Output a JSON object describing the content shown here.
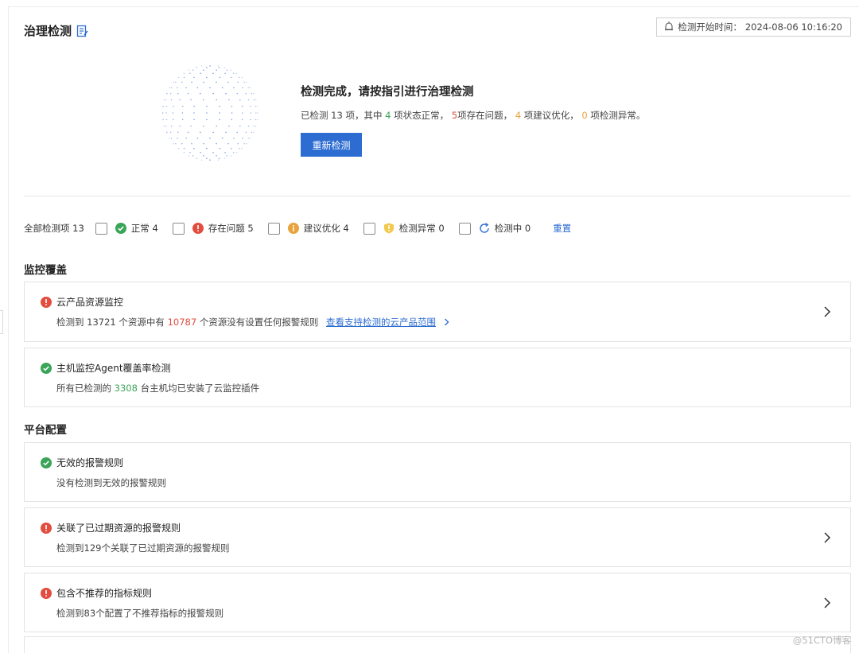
{
  "header": {
    "title": "治理检测",
    "start_time_label": "检测开始时间：",
    "start_time_value": "2024-08-06 10:16:20"
  },
  "hero": {
    "title": "检测完成，请按指引进行治理检测",
    "summary": {
      "prefix": "已检测 13 项，其中",
      "normal_count": "4",
      "normal_text": "项状态正常，",
      "problem_count": "5",
      "problem_text": "项存在问题，",
      "suggest_count": "4",
      "suggest_text": "项建议优化，",
      "abnormal_count": "0",
      "abnormal_text": "项检测异常。"
    },
    "recheck_button": "重新检测"
  },
  "filters": {
    "all_label": "全部检测项 13",
    "items": [
      {
        "label": "正常 4",
        "icon": "check-circle-icon",
        "color": "#3aa559"
      },
      {
        "label": "存在问题 5",
        "icon": "exclamation-circle-icon",
        "color": "#e34d3f"
      },
      {
        "label": "建议优化 4",
        "icon": "info-circle-icon",
        "color": "#e8a33d"
      },
      {
        "label": "检测异常 0",
        "icon": "shield-warning-icon",
        "color": "#f2c94c"
      },
      {
        "label": "检测中 0",
        "icon": "refresh-icon",
        "color": "#2d6dd2"
      }
    ],
    "reset_label": "重置"
  },
  "sections": {
    "monitoring": {
      "title": "监控覆盖",
      "cards": [
        {
          "status": "problem",
          "title": "云产品资源监控",
          "desc_prefix": "检测到 13721 个资源中有",
          "desc_highlight": "10787",
          "desc_suffix": "个资源没有设置任何报警规则",
          "link": "查看支持检测的云产品范围"
        },
        {
          "status": "normal",
          "title": "主机监控Agent覆盖率检测",
          "desc_prefix": "所有已检测的",
          "desc_highlight": "3308",
          "desc_suffix": "台主机均已安装了云监控插件"
        }
      ]
    },
    "platform": {
      "title": "平台配置",
      "cards": [
        {
          "status": "normal",
          "title": "无效的报警规则",
          "desc": "没有检测到无效的报警规则"
        },
        {
          "status": "problem",
          "title": "关联了已过期资源的报警规则",
          "desc": "检测到129个关联了已过期资源的报警规则"
        },
        {
          "status": "problem",
          "title": "包含不推荐的指标规则",
          "desc": "检测到83个配置了不推荐指标的报警规则"
        }
      ]
    }
  },
  "colors": {
    "primary": "#2d6dd2",
    "normal": "#3aa559",
    "problem": "#e34d3f",
    "suggest": "#e8a33d"
  },
  "watermark": "@51CTO博客"
}
